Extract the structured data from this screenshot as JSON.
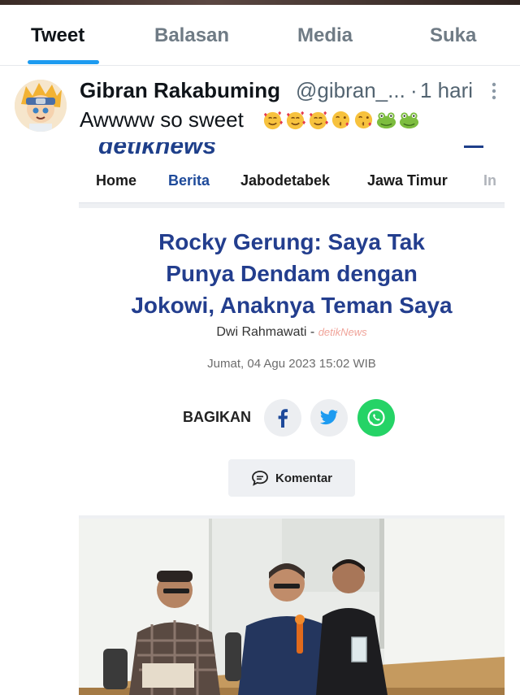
{
  "tabs": [
    {
      "label": "Tweet",
      "active": true
    },
    {
      "label": "Balasan",
      "active": false
    },
    {
      "label": "Media",
      "active": false
    },
    {
      "label": "Suka",
      "active": false
    }
  ],
  "tweet": {
    "name": "Gibran Rakabuming",
    "handle": "@gibran_...",
    "separator": "·",
    "time": "1 hari",
    "text": "Awwww so sweet",
    "emojis": [
      "smiling-face-with-hearts",
      "smiling-face-with-hearts",
      "smiling-face-with-hearts",
      "face-blowing-kiss",
      "face-blowing-kiss",
      "frog",
      "frog"
    ]
  },
  "article": {
    "site_logo_partial": "detiknews",
    "nav": [
      "Home",
      "Berita",
      "Jabodetabek",
      "Jawa Timur",
      "In"
    ],
    "active_nav": "Berita",
    "headline_lines": [
      "Rocky Gerung: Saya Tak",
      "Punya Dendam dengan",
      "Jokowi, Anaknya Teman Saya"
    ],
    "author": "Dwi Rahmawati",
    "byline_separator": "-",
    "source": "detikNews",
    "date": "Jumat, 04 Agu 2023 15:02 WIB",
    "share_label": "BAGIKAN",
    "share_buttons": [
      "facebook-icon",
      "twitter-icon",
      "whatsapp-icon"
    ],
    "comment_label": "Komentar"
  },
  "colors": {
    "accent": "#1d9bf0",
    "headline": "#233e8e",
    "whatsapp": "#25d366"
  }
}
